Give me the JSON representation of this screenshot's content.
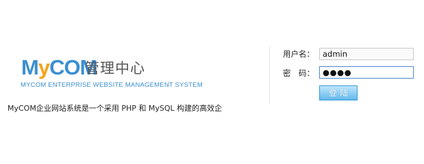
{
  "logo": {
    "my_m": "M",
    "my_y": "y",
    "my_com": "COM",
    "admin_center": "管理中心",
    "subtitle": "MYCOM ENTERPRISE WEBSITE MANAGEMENT SYSTEM"
  },
  "description": "MyCOM企业网站系统是一个采用 PHP 和 MySQL 构建的高效企",
  "login": {
    "username_label": "用户名：",
    "username_value": "admin",
    "password_label": "密　码：",
    "password_masked": "●●●●",
    "submit_label": "登陆"
  },
  "colors": {
    "brand_blue": "#3a8fd2",
    "brand_orange": "#f4a21c",
    "button_top": "#bfe6fb",
    "button_bottom": "#62b9ec"
  }
}
